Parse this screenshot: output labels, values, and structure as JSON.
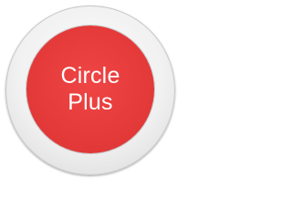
{
  "logo": {
    "line1": "Circle",
    "line2": "Plus"
  },
  "colors": {
    "accent": "#e43a3a",
    "ring": "#f1f1f1",
    "text": "#ffffff"
  }
}
